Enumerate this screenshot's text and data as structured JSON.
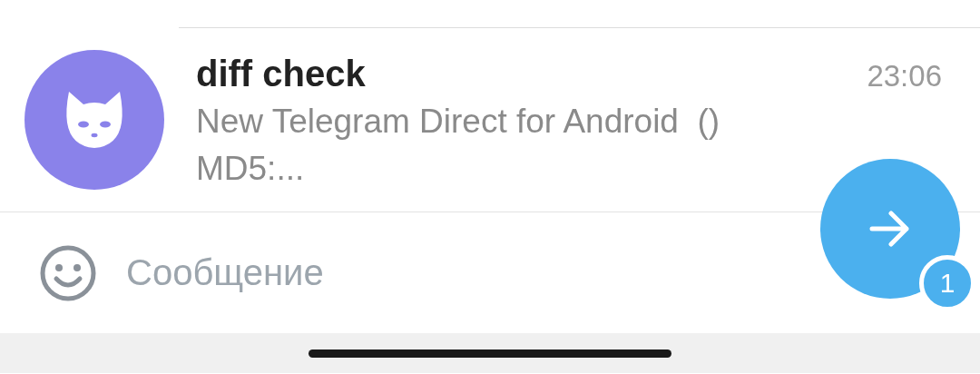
{
  "chat": {
    "name": "diff check",
    "time": "23:06",
    "preview": "New Telegram Direct for Android  ()\nMD5:..."
  },
  "composer": {
    "placeholder": "Сообщение"
  },
  "send_button": {
    "badge": "1"
  }
}
